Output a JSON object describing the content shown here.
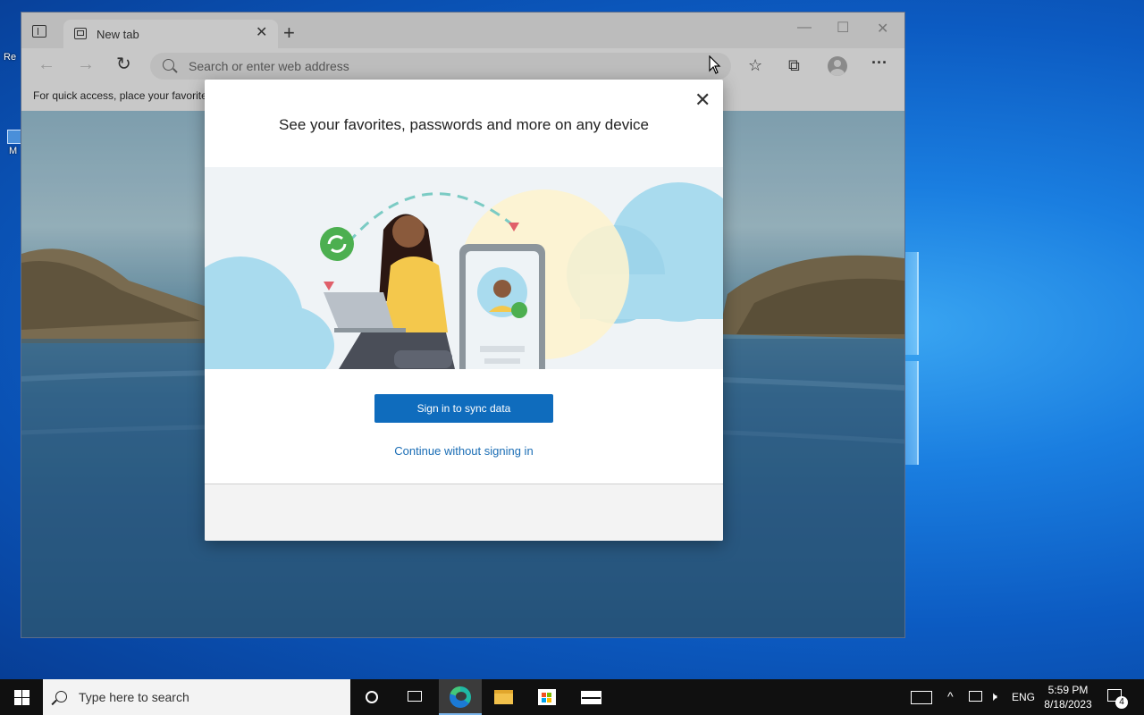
{
  "desktop": {
    "icon_labels": [
      "Re",
      "M"
    ]
  },
  "browser": {
    "tab": {
      "title": "New tab"
    },
    "address_bar": {
      "placeholder": "Search or enter web address"
    },
    "favorites_bar": {
      "text": "For quick access, place your favorite"
    }
  },
  "modal": {
    "title": "See your favorites, passwords and more on any device",
    "primary_button": "Sign in to sync data",
    "secondary_link": "Continue without signing in"
  },
  "taskbar": {
    "search_placeholder": "Type here to search",
    "language": "ENG",
    "time": "5:59 PM",
    "date": "8/18/2023",
    "notification_count": "4"
  },
  "colors": {
    "accent": "#0f6cbd",
    "link": "#1a6db5",
    "taskbar": "#101010"
  },
  "icons": [
    "tab-actions-icon",
    "new-tab-icon",
    "back-arrow-icon",
    "forward-arrow-icon",
    "refresh-icon",
    "search-icon",
    "favorites-icon",
    "collections-icon",
    "profile-icon",
    "more-icon",
    "close-icon",
    "windows-start-icon",
    "task-view-icon",
    "edge-icon",
    "file-explorer-icon",
    "store-icon",
    "mail-icon",
    "network-icon",
    "volume-muted-icon",
    "notification-icon"
  ]
}
